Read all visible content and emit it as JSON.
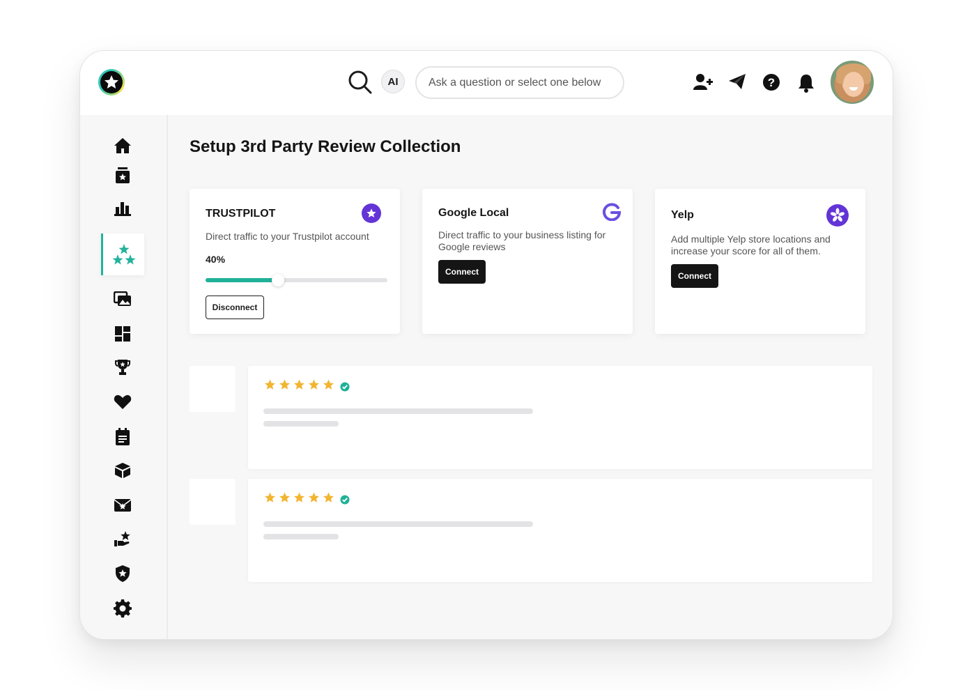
{
  "header": {
    "ai_label": "AI",
    "ask_placeholder": "Ask a question or select one below"
  },
  "page": {
    "title": "Setup 3rd Party Review Collection"
  },
  "sidebar": {
    "items": [
      {
        "icon": "home-icon"
      },
      {
        "icon": "review-box-icon"
      },
      {
        "icon": "bar-chart-icon"
      },
      {
        "icon": "stars-icon",
        "active": true
      },
      {
        "icon": "gallery-icon"
      },
      {
        "icon": "dashboard-icon"
      },
      {
        "icon": "trophy-icon"
      },
      {
        "icon": "heart-icon"
      },
      {
        "icon": "clipboard-icon"
      },
      {
        "icon": "cube-icon"
      },
      {
        "icon": "mail-star-icon"
      },
      {
        "icon": "hand-star-icon"
      },
      {
        "icon": "shield-star-icon"
      },
      {
        "icon": "settings-gear-icon"
      }
    ]
  },
  "cards": {
    "trustpilot": {
      "title": "TRUSTPILOT",
      "desc": "Direct traffic to your Trustpilot account",
      "progress_label": "40%",
      "progress": 0.4,
      "button": "Disconnect"
    },
    "google": {
      "title": "Google Local",
      "desc": "Direct traffic to your business listing for Google reviews",
      "button": "Connect"
    },
    "yelp": {
      "title": "Yelp",
      "desc": "Add multiple Yelp store locations and increase your score for all of them.",
      "button": "Connect"
    }
  },
  "reviews": [
    {
      "stars": 5,
      "verified": true
    },
    {
      "stars": 5,
      "verified": true
    }
  ],
  "colors": {
    "accent": "#1fb197",
    "brand_purple": "#6334d6",
    "star": "#f2b531",
    "dark_button": "#151515"
  }
}
